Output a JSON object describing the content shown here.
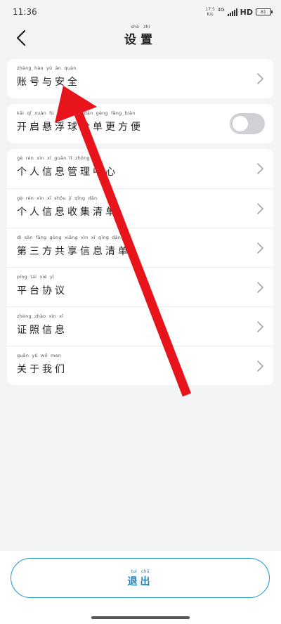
{
  "status_bar": {
    "time": "11:36",
    "net_speed_value": "17.5",
    "net_speed_unit": "K/s",
    "network": "4G",
    "hd": "HD",
    "battery": "81"
  },
  "nav": {
    "title_pinyin": "shè zhì",
    "title": "设置"
  },
  "groups": [
    {
      "items": [
        {
          "pinyin": "zhàng hào yǔ ān quán",
          "label": "账号与安全"
        }
      ]
    },
    {
      "items": [
        {
          "pinyin": "kāi qǐ xuán fú qiú qiǎng dān gèng fāng biàn",
          "label": "开启悬浮球抢单更方便",
          "toggle": false
        }
      ]
    },
    {
      "items": [
        {
          "pinyin": "gè rén xìn xī guǎn lǐ zhōng xīn",
          "label": "个人信息管理中心"
        },
        {
          "pinyin": "gè rén xìn xī shōu jí qīng dān",
          "label": "个人信息收集清单"
        },
        {
          "pinyin": "dì sān fāng gòng xiǎng xìn xī qīng dān",
          "label": "第三方共享信息清单"
        },
        {
          "pinyin": "píng tái xié yì",
          "label": "平台协议"
        },
        {
          "pinyin": "zhèng zhào xìn xī",
          "label": "证照信息"
        },
        {
          "pinyin": "guān yú wǒ men",
          "label": "关于我们"
        }
      ]
    }
  ],
  "logout": {
    "pinyin": "tuì chū",
    "label": "退出"
  },
  "colors": {
    "accent": "#2196c7",
    "annotation_arrow": "#e8141b",
    "toggle_off": "#cfd1d4",
    "background": "#f3f4f6"
  }
}
